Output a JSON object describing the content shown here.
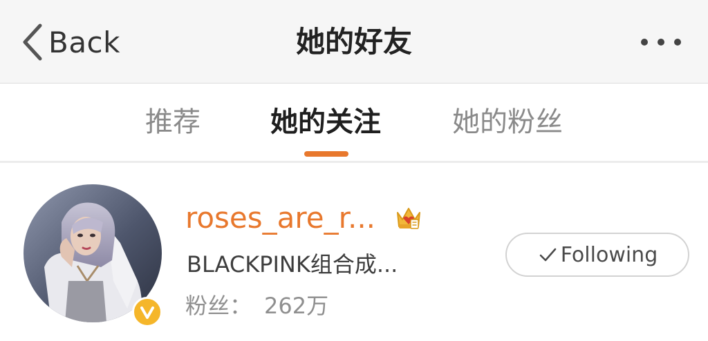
{
  "nav": {
    "back_label": "Back",
    "title": "她的好友",
    "more_icon": "more-dots-icon",
    "back_icon": "chevron-left-icon"
  },
  "tabs": [
    {
      "label": "推荐",
      "active": false
    },
    {
      "label": "她的关注",
      "active": true
    },
    {
      "label": "她的粉丝",
      "active": false
    }
  ],
  "user": {
    "name": "roses_are_r...",
    "bio": "BLACKPINK组合成...",
    "followers_label": "粉丝：",
    "followers_count": "262万",
    "follow_status": "Following",
    "badge_icon": "verified-v-icon",
    "member_icon": "crown-icon",
    "avatar_icon": "avatar-image"
  },
  "colors": {
    "accent_orange": "#e8782d",
    "verified_yellow": "#f5b62a",
    "crown_red": "#d9412b",
    "text_dark": "#222222",
    "text_gray": "#8a8a8a"
  }
}
